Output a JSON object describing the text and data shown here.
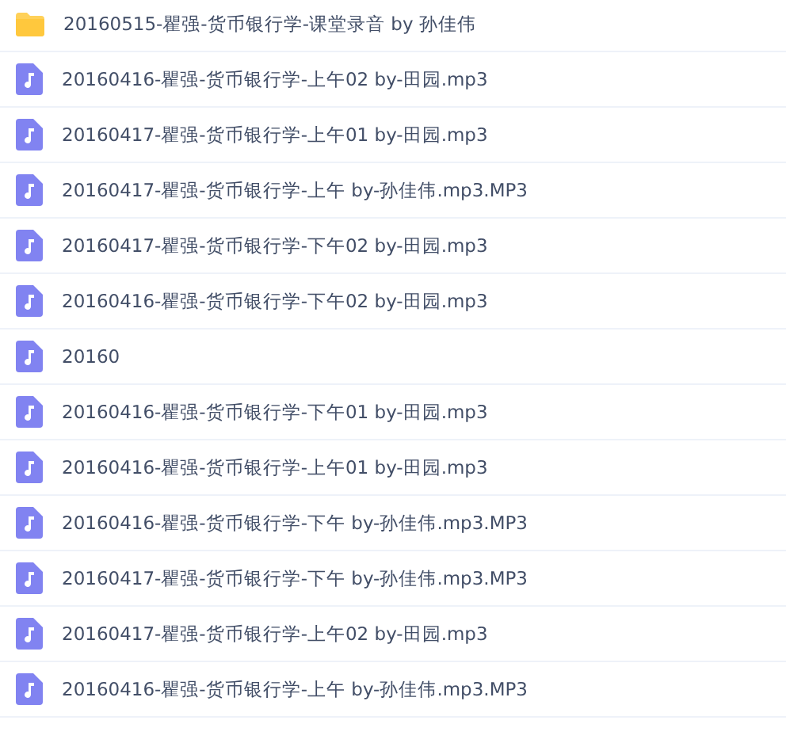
{
  "files": [
    {
      "kind": "folder",
      "name": "20160515-瞿强-货币银行学-课堂录音 by 孙佳伟"
    },
    {
      "kind": "audio",
      "name": "20160416-瞿强-货币银行学-上午02 by-田园.mp3"
    },
    {
      "kind": "audio",
      "name": "20160417-瞿强-货币银行学-上午01 by-田园.mp3"
    },
    {
      "kind": "audio",
      "name": "20160417-瞿强-货币银行学-上午 by-孙佳伟.mp3.MP3"
    },
    {
      "kind": "audio",
      "name": "20160417-瞿强-货币银行学-下午02 by-田园.mp3"
    },
    {
      "kind": "audio",
      "name": "20160416-瞿强-货币银行学-下午02 by-田园.mp3"
    },
    {
      "kind": "audio",
      "name": "20160"
    },
    {
      "kind": "audio",
      "name": "20160416-瞿强-货币银行学-下午01 by-田园.mp3"
    },
    {
      "kind": "audio",
      "name": "20160416-瞿强-货币银行学-上午01 by-田园.mp3"
    },
    {
      "kind": "audio",
      "name": "20160416-瞿强-货币银行学-下午 by-孙佳伟.mp3.MP3"
    },
    {
      "kind": "audio",
      "name": "20160417-瞿强-货币银行学-下午 by-孙佳伟.mp3.MP3"
    },
    {
      "kind": "audio",
      "name": "20160417-瞿强-货币银行学-上午02 by-田园.mp3"
    },
    {
      "kind": "audio",
      "name": "20160416-瞿强-货币银行学-上午 by-孙佳伟.mp3.MP3"
    }
  ]
}
